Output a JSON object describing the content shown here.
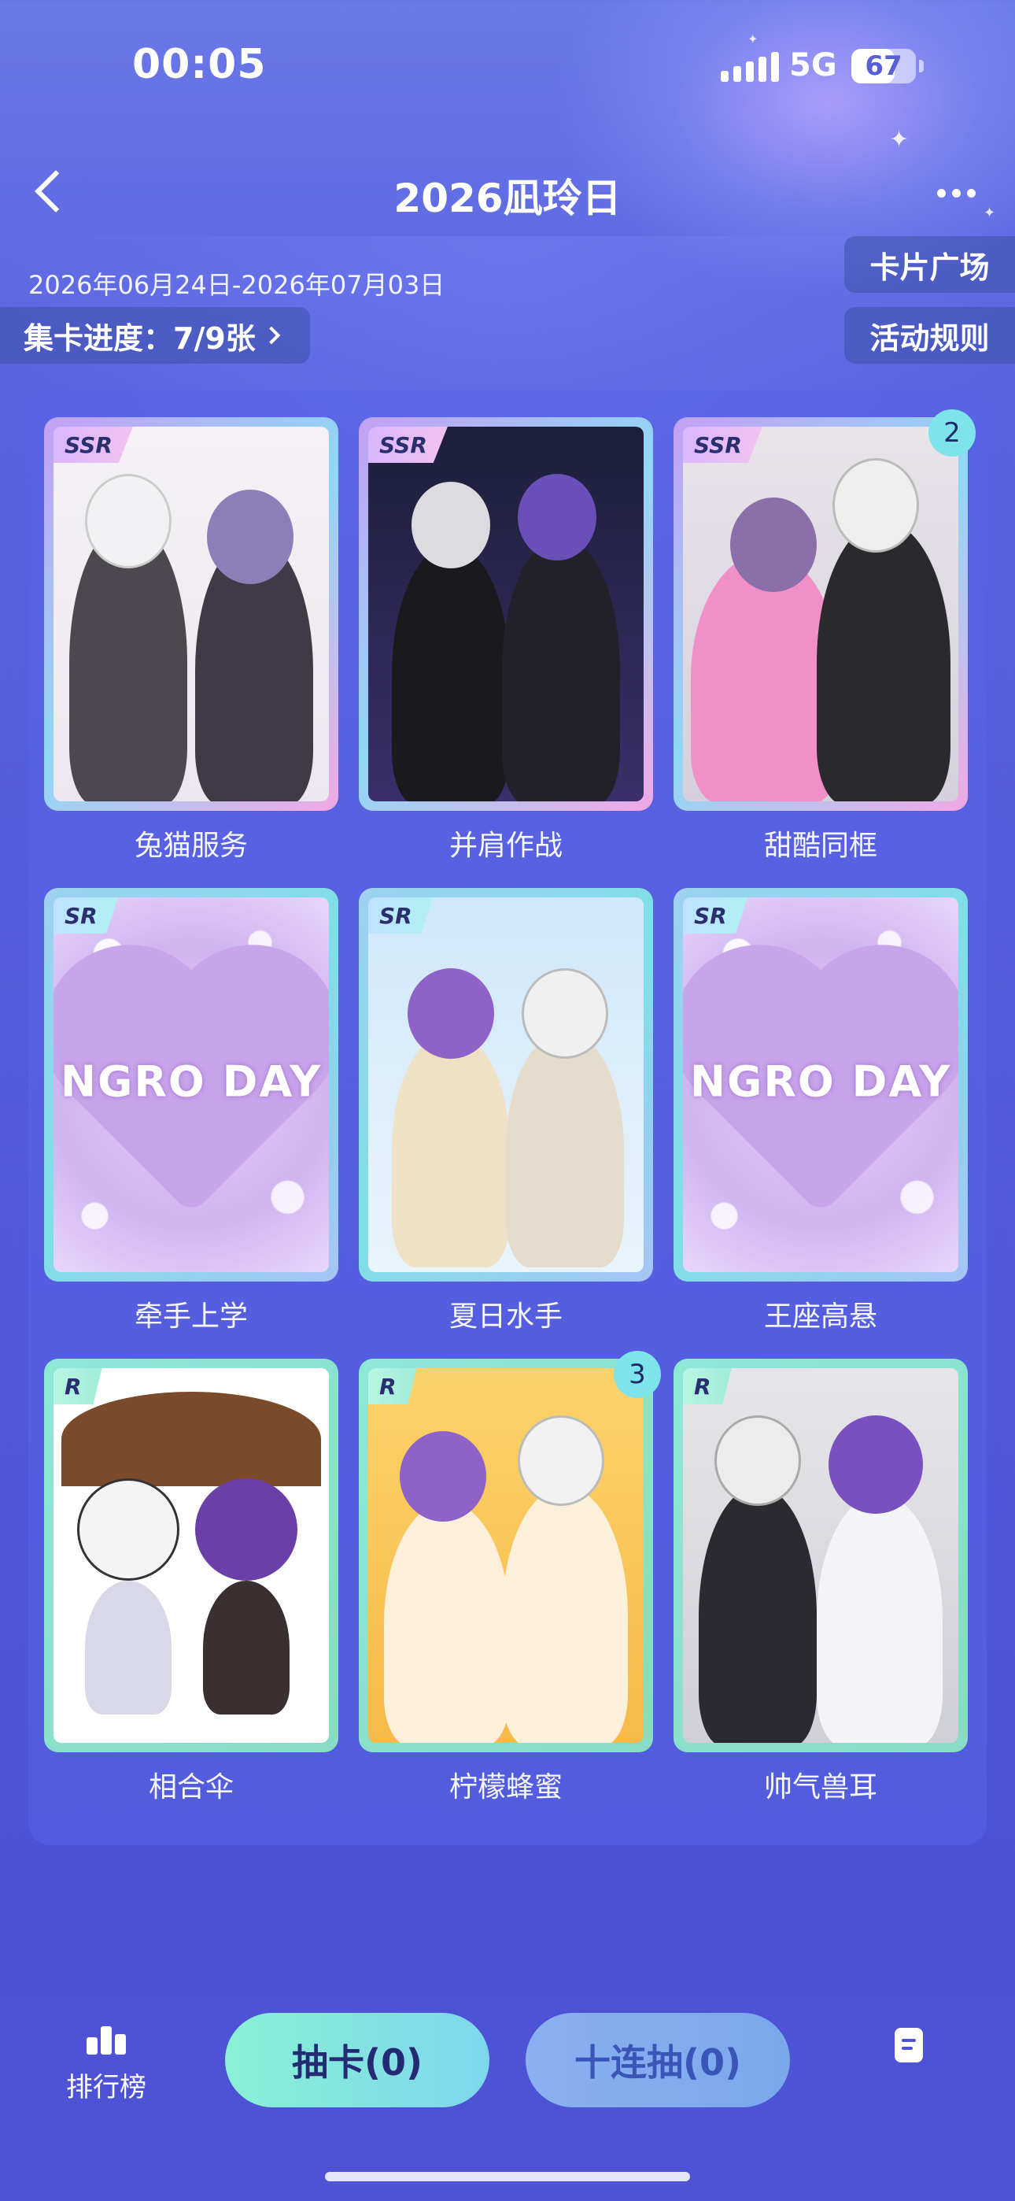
{
  "status_bar": {
    "time": "00:05",
    "network": "5G",
    "battery": "67",
    "battery_level": 0.67
  },
  "header": {
    "title": "2026凪玲日"
  },
  "event": {
    "date_range": "2026年06月24日-2026年07月03日",
    "progress_label": "集卡进度：7/9张",
    "card_square_label": "卡片广场",
    "rules_label": "活动规则"
  },
  "cards": [
    {
      "rarity": "SSR",
      "name": "兔猫服务",
      "count": ""
    },
    {
      "rarity": "SSR",
      "name": "并肩作战",
      "count": ""
    },
    {
      "rarity": "SSR",
      "name": "甜酷同框",
      "count": "2"
    },
    {
      "rarity": "SR",
      "name": "牵手上学",
      "count": "",
      "art_text": "NGRO DAY"
    },
    {
      "rarity": "SR",
      "name": "夏日水手",
      "count": ""
    },
    {
      "rarity": "SR",
      "name": "王座高悬",
      "count": "",
      "art_text": "NGRO DAY"
    },
    {
      "rarity": "R",
      "name": "相合伞",
      "count": ""
    },
    {
      "rarity": "R",
      "name": "柠檬蜂蜜",
      "count": "3"
    },
    {
      "rarity": "R",
      "name": "帅气兽耳",
      "count": ""
    }
  ],
  "bottom_bar": {
    "rank_label": "排行榜",
    "draw_one_label": "抽卡(0)",
    "draw_ten_label": "十连抽(0)"
  },
  "icons": {
    "rank": "bar-chart-icon",
    "back": "chevron-left-icon",
    "more": "more-dots-icon",
    "doc": "document-icon"
  }
}
